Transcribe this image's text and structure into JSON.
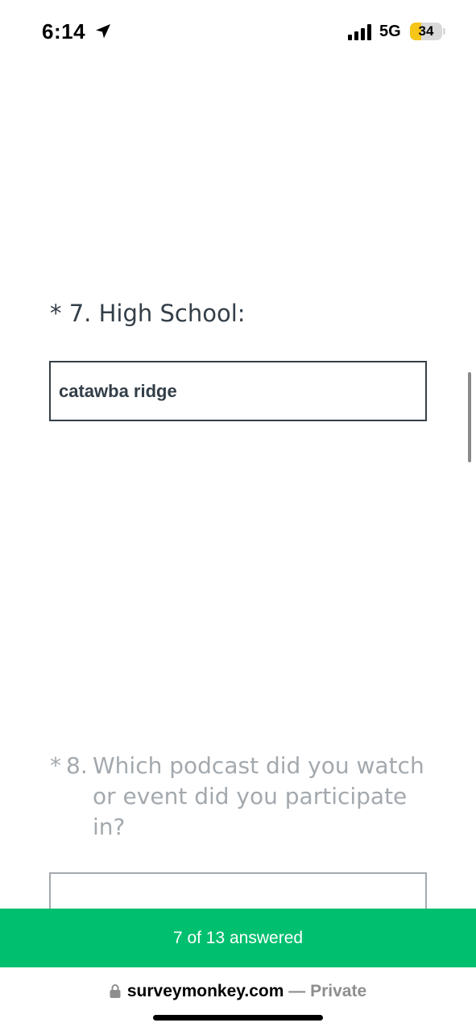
{
  "status_bar": {
    "time": "6:14",
    "network": "5G",
    "battery": "34",
    "battery_level": 0.34,
    "icons": [
      "location-arrow-icon",
      "signal-icon",
      "battery-icon"
    ]
  },
  "question7": {
    "asterisk": "*",
    "title": "* 7. High School:",
    "value": "catawba ridge"
  },
  "question8": {
    "asterisk": "*",
    "number": "8.",
    "text": "Which podcast did you watch or event did you participate in?",
    "value": ""
  },
  "progress": {
    "label": "7 of 13 answered",
    "answered": 7,
    "total": 13
  },
  "browser": {
    "domain": "surveymonkey.com",
    "separator": "—",
    "privacy": "Private"
  },
  "colors": {
    "accent_green": "#00bf6f",
    "text_dark": "#333e48",
    "text_muted": "#a3a9ae"
  }
}
